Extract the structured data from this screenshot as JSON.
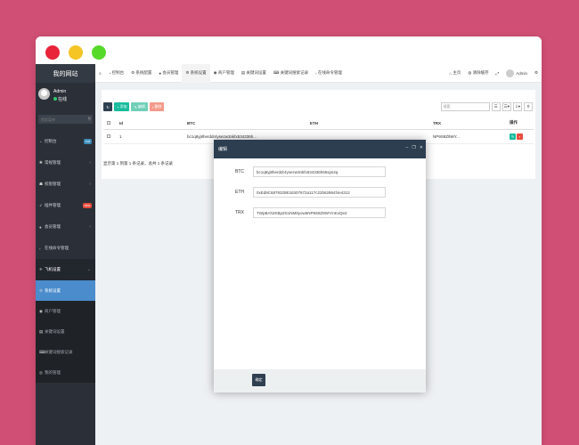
{
  "sidebar": {
    "brand": "我的网站",
    "user": {
      "name": "Admin",
      "status": "在线"
    },
    "search_placeholder": "搜索菜单",
    "items": [
      {
        "label": "控制台",
        "icon": "dashboard-icon",
        "badge": "hot",
        "badge_color": "#3c8dbc"
      },
      {
        "label": "常规管理",
        "icon": "cogs-icon",
        "arrow": "‹"
      },
      {
        "label": "权限管理",
        "icon": "group-icon",
        "arrow": "‹"
      },
      {
        "label": "插件管理",
        "icon": "rocket-icon",
        "badge": "new",
        "badge_color": "#e74c3c"
      },
      {
        "label": "会员管理",
        "icon": "user-icon",
        "arrow": "‹"
      },
      {
        "label": "在线命令管理",
        "icon": "terminal-icon"
      },
      {
        "label": "飞机设置",
        "icon": "plane-icon",
        "arrow": "⌄"
      }
    ],
    "subitems": [
      {
        "label": "系统设置",
        "icon": "gear-icon",
        "active": true
      },
      {
        "label": "商户管理",
        "icon": "users-icon"
      },
      {
        "label": "关键词设置",
        "icon": "file-icon"
      },
      {
        "label": "关键词搜索记录",
        "icon": "keyboard-icon"
      },
      {
        "label": "我的管理",
        "icon": "circle-icon"
      }
    ]
  },
  "topbar": {
    "tabs": [
      {
        "label": "控制台",
        "icon": "≡"
      },
      {
        "label": "系统配置",
        "icon": "⚙"
      },
      {
        "label": "会员管理",
        "icon": "👤"
      },
      {
        "label": "系统设置",
        "icon": "⚙",
        "active": true
      },
      {
        "label": "商户管理",
        "icon": "◉"
      },
      {
        "label": "关键词设置",
        "icon": "▤"
      },
      {
        "label": "关键词搜索记录",
        "icon": "⌨"
      },
      {
        "label": "在线命令管理",
        "icon": "›_"
      }
    ],
    "home": "主页",
    "clear_cache": "清除缓存",
    "user": "Admin"
  },
  "toolbar": {
    "add": "添加",
    "edit": "编辑",
    "delete": "删除",
    "search_placeholder": "搜索"
  },
  "table": {
    "headers": [
      "Id",
      "BTC",
      "ETH",
      "TRX",
      "操作"
    ],
    "rows": [
      {
        "id": "1",
        "btc": "bc1q8yj8herddr4ysezw3nkfx534336h...",
        "eth": "",
        "trx": "NP9S8Z9WY..."
      }
    ],
    "pagination": "显示第 1 到第 1 条记录，总共 1 条记录"
  },
  "modal": {
    "title": "编辑",
    "fields": [
      {
        "label": "BTC",
        "value": "bc1q8yj8herddr4ysezw3nkfx534336h65sps4q"
      },
      {
        "label": "ETH",
        "value": "0xEd9C6879329E2d407672a117c22b62864f4e4312"
      },
      {
        "label": "TRX",
        "value": "TWpBAh2KBpZS1NM8yow5NP9S8Z9WYmKxQe2"
      }
    ],
    "ok": "确定"
  }
}
